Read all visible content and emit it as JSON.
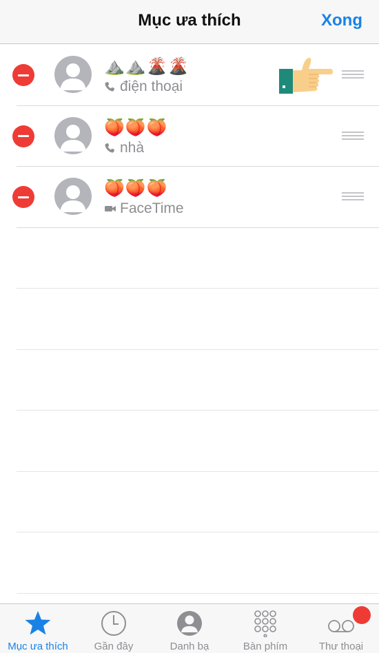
{
  "nav": {
    "title": "Mục ưa thích",
    "done_label": "Xong"
  },
  "favorites": [
    {
      "name": "⛰️⛰️🌋🌋",
      "sub": "điện thoại",
      "sub_icon": "phone-icon"
    },
    {
      "name": "🍑🍑🍑",
      "sub": "nhà",
      "sub_icon": "phone-icon"
    },
    {
      "name": "🍑🍑🍑",
      "sub": "FaceTime",
      "sub_icon": "video-camera-icon"
    }
  ],
  "tabbar": {
    "tabs": [
      {
        "label": "Mục ưa thích",
        "icon": "star-icon",
        "active": true
      },
      {
        "label": "Gần đây",
        "icon": "clock-icon",
        "active": false
      },
      {
        "label": "Danh bạ",
        "icon": "contact-person-icon",
        "active": false
      },
      {
        "label": "Bàn phím",
        "icon": "keypad-icon",
        "active": false
      },
      {
        "label": "Thư thoại",
        "icon": "voicemail-icon",
        "active": false
      }
    ]
  },
  "colors": {
    "accent": "#1a82e6",
    "delete": "#ef3b35",
    "badge": "#ef3b35",
    "avatar": "#b3b5ba"
  }
}
